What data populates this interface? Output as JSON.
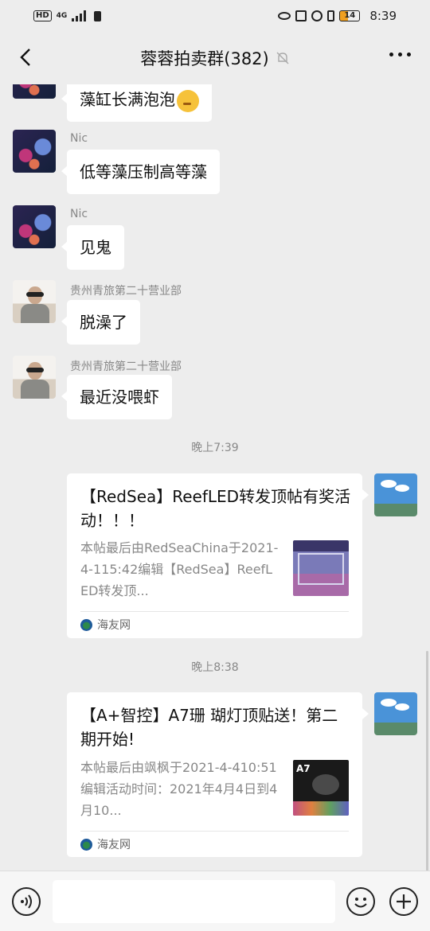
{
  "status_bar": {
    "hd": "HD",
    "network": "4G",
    "battery": "14",
    "time": "8:39"
  },
  "nav": {
    "title": "蓉蓉拍卖群(382)"
  },
  "messages": [
    {
      "sender": "",
      "text": "藻缸长满泡泡"
    },
    {
      "sender": "Nic",
      "text": "低等藻压制高等藻"
    },
    {
      "sender": "Nic",
      "text": "见鬼"
    },
    {
      "sender": "贵州青旅第二十营业部",
      "text": "脱澡了"
    },
    {
      "sender": "贵州青旅第二十营业部",
      "text": "最近没喂虾"
    }
  ],
  "timestamps": [
    "晚上7:39",
    "晚上8:38"
  ],
  "cards": [
    {
      "title": "【RedSea】ReefLED转发顶帖有奖活动！！！",
      "desc": "本帖最后由RedSeaChina于2021-4-115:42编辑【RedSea】ReefLED转发顶...",
      "source": "海友网"
    },
    {
      "title": "【A+智控】A7珊 瑚灯顶贴送！第二期开始!",
      "desc": "本帖最后由飒枫于2021-4-410:51编辑活动时间：2021年4月4日到4月10...",
      "source": "海友网",
      "thumb_label": "A7"
    }
  ],
  "input": {
    "placeholder": ""
  }
}
